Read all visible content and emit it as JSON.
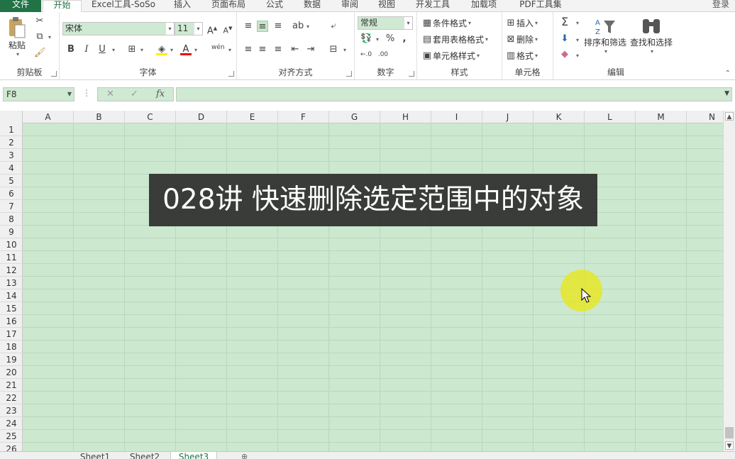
{
  "ribbon_tabs": [
    "文件",
    "开始",
    "Excel工具-SoSo",
    "插入",
    "页面布局",
    "公式",
    "数据",
    "审阅",
    "视图",
    "开发工具",
    "加载项",
    "PDF工具集"
  ],
  "login_label": "登录",
  "clipboard": {
    "paste_label": "粘贴",
    "group_label": "剪贴板"
  },
  "font": {
    "name": "宋体",
    "size": "11",
    "bold": "B",
    "italic": "I",
    "underline": "U",
    "pinyin": "wén",
    "group_label": "字体"
  },
  "alignment": {
    "group_label": "对齐方式"
  },
  "number": {
    "format": "常规",
    "percent": "%",
    "comma": ",",
    "group_label": "数字"
  },
  "styles": {
    "conditional": "条件格式",
    "table": "套用表格格式",
    "cell": "单元格样式",
    "group_label": "样式"
  },
  "cells": {
    "insert": "插入",
    "delete": "删除",
    "format": "格式",
    "group_label": "单元格"
  },
  "editing": {
    "sort_filter": "排序和筛选",
    "find_select": "查找和选择",
    "group_label": "编辑"
  },
  "formula_bar": {
    "name_box": "F8",
    "cancel": "✕",
    "enter": "✓",
    "fx": "fx",
    "value": ""
  },
  "columns": [
    "A",
    "B",
    "C",
    "D",
    "E",
    "F",
    "G",
    "H",
    "I",
    "J",
    "K",
    "L",
    "M",
    "N"
  ],
  "rows": [
    "1",
    "2",
    "3",
    "4",
    "5",
    "6",
    "7",
    "8",
    "9",
    "10",
    "11",
    "12",
    "13",
    "14",
    "15",
    "16",
    "17",
    "18",
    "19",
    "20",
    "21",
    "22",
    "23",
    "24",
    "25",
    "26"
  ],
  "sheets": [
    "Sheet1",
    "Sheet2",
    "Sheet3"
  ],
  "overlay_title": "028讲 快速删除选定范围中的对象",
  "colors": {
    "accent": "#217346",
    "grid_bg": "#cce8cf",
    "banner_bg": "#2d2d2d",
    "highlight": "#e6e628"
  }
}
